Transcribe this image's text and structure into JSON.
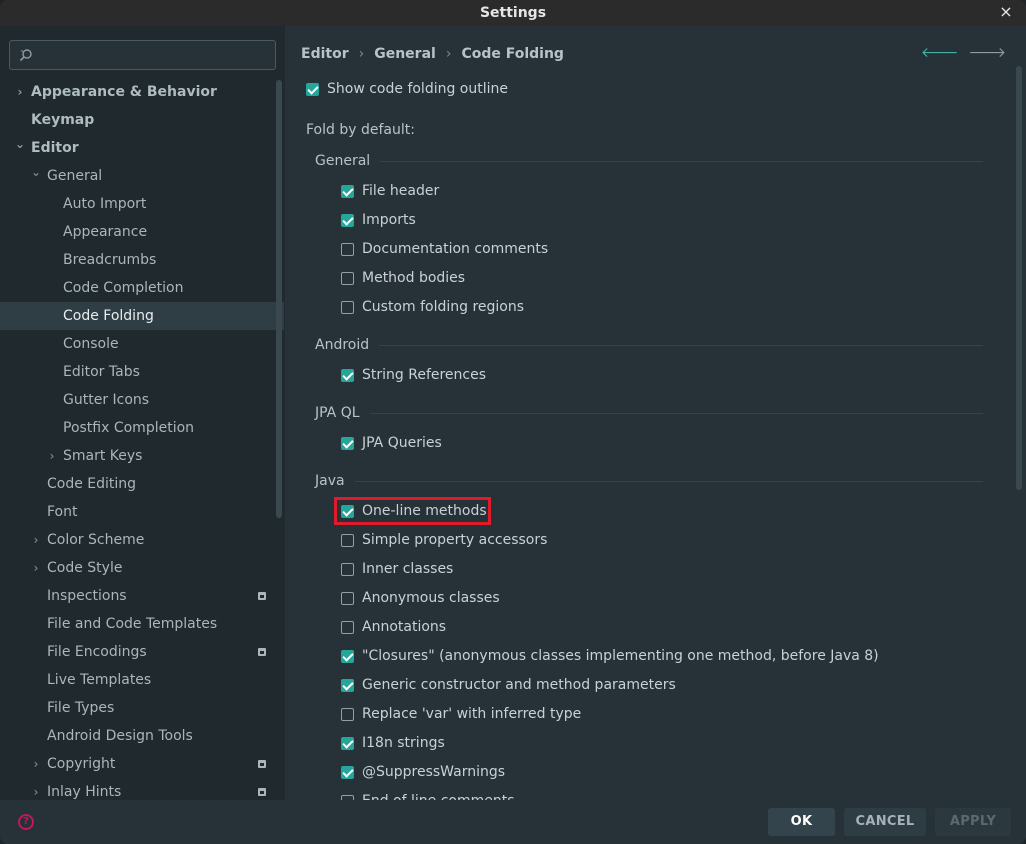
{
  "window": {
    "title": "Settings"
  },
  "search": {
    "value": "",
    "placeholder": ""
  },
  "sidebar": {
    "items": [
      {
        "label": "Appearance & Behavior",
        "level": 0,
        "chevron": "right",
        "bold": true
      },
      {
        "label": "Keymap",
        "level": 0,
        "chevron": "",
        "bold": true
      },
      {
        "label": "Editor",
        "level": 0,
        "chevron": "down",
        "bold": true
      },
      {
        "label": "General",
        "level": 1,
        "chevron": "down"
      },
      {
        "label": "Auto Import",
        "level": 2,
        "chevron": ""
      },
      {
        "label": "Appearance",
        "level": 2,
        "chevron": ""
      },
      {
        "label": "Breadcrumbs",
        "level": 2,
        "chevron": ""
      },
      {
        "label": "Code Completion",
        "level": 2,
        "chevron": ""
      },
      {
        "label": "Code Folding",
        "level": 2,
        "chevron": "",
        "selected": true
      },
      {
        "label": "Console",
        "level": 2,
        "chevron": ""
      },
      {
        "label": "Editor Tabs",
        "level": 2,
        "chevron": ""
      },
      {
        "label": "Gutter Icons",
        "level": 2,
        "chevron": ""
      },
      {
        "label": "Postfix Completion",
        "level": 2,
        "chevron": ""
      },
      {
        "label": "Smart Keys",
        "level": 2,
        "chevron": "right"
      },
      {
        "label": "Code Editing",
        "level": 1,
        "chevron": ""
      },
      {
        "label": "Font",
        "level": 1,
        "chevron": ""
      },
      {
        "label": "Color Scheme",
        "level": 1,
        "chevron": "right"
      },
      {
        "label": "Code Style",
        "level": 1,
        "chevron": "right"
      },
      {
        "label": "Inspections",
        "level": 1,
        "chevron": "",
        "badge": true
      },
      {
        "label": "File and Code Templates",
        "level": 1,
        "chevron": ""
      },
      {
        "label": "File Encodings",
        "level": 1,
        "chevron": "",
        "badge": true
      },
      {
        "label": "Live Templates",
        "level": 1,
        "chevron": ""
      },
      {
        "label": "File Types",
        "level": 1,
        "chevron": ""
      },
      {
        "label": "Android Design Tools",
        "level": 1,
        "chevron": ""
      },
      {
        "label": "Copyright",
        "level": 1,
        "chevron": "right",
        "badge": true
      },
      {
        "label": "Inlay Hints",
        "level": 1,
        "chevron": "right",
        "badge": true
      }
    ]
  },
  "breadcrumb": {
    "items": [
      "Editor",
      "General",
      "Code Folding"
    ],
    "separator": "›"
  },
  "main": {
    "show_outline": {
      "label": "Show code folding outline",
      "checked": true
    },
    "fold_by_default_label": "Fold by default:",
    "groups": [
      {
        "title": "General",
        "options": [
          {
            "label": "File header",
            "checked": true
          },
          {
            "label": "Imports",
            "checked": true
          },
          {
            "label": "Documentation comments",
            "checked": false
          },
          {
            "label": "Method bodies",
            "checked": false
          },
          {
            "label": "Custom folding regions",
            "checked": false
          }
        ]
      },
      {
        "title": "Android",
        "options": [
          {
            "label": "String References",
            "checked": true
          }
        ]
      },
      {
        "title": "JPA QL",
        "options": [
          {
            "label": "JPA Queries",
            "checked": true
          }
        ]
      },
      {
        "title": "Java",
        "options": [
          {
            "label": "One-line methods",
            "checked": true,
            "highlighted": true
          },
          {
            "label": "Simple property accessors",
            "checked": false
          },
          {
            "label": "Inner classes",
            "checked": false
          },
          {
            "label": "Anonymous classes",
            "checked": false
          },
          {
            "label": "Annotations",
            "checked": false
          },
          {
            "label": "\"Closures\" (anonymous classes implementing one method, before Java 8)",
            "checked": true
          },
          {
            "label": "Generic constructor and method parameters",
            "checked": true
          },
          {
            "label": "Replace 'var' with inferred type",
            "checked": false
          },
          {
            "label": "I18n strings",
            "checked": true
          },
          {
            "label": "@SuppressWarnings",
            "checked": true
          },
          {
            "label": "End of line comments",
            "checked": false
          }
        ]
      }
    ]
  },
  "footer": {
    "ok": "OK",
    "cancel": "CANCEL",
    "apply": "APPLY",
    "help_icon": "?"
  },
  "icons": {
    "close": "×",
    "back": "🡐",
    "forward": "🡒"
  },
  "colors": {
    "accent": "#26a69a",
    "highlight": "#e21b2a",
    "background": "#263238",
    "sidebar": "#1f292e"
  }
}
